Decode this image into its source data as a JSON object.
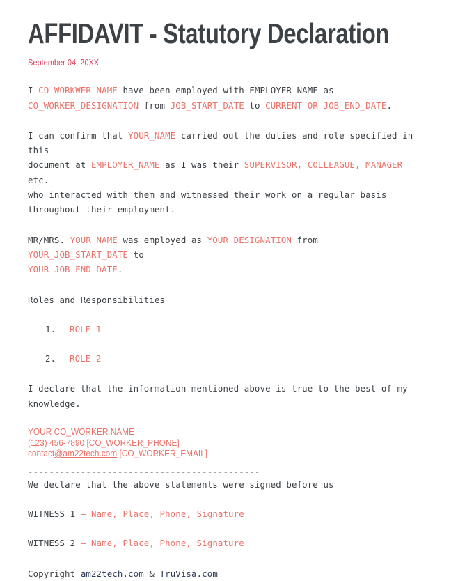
{
  "document": {
    "title": "AFFIDAVIT - Statutory Declaration",
    "date": "September 04, 20XX"
  },
  "paragraph1": {
    "t1": "I ",
    "co_worker_name": "CO_WORKWER_NAME",
    "t2": " have been employed with EMPLOYER_NAME as\n",
    "co_worker_designation": "CO_WORKER_DESIGNATION",
    "t3": " from ",
    "job_start_date": "JOB_START_DATE",
    "t4": " to ",
    "job_end_date": "CURRENT OR JOB_END_DATE",
    "t5": "."
  },
  "paragraph2": {
    "t1": "I can confirm that ",
    "your_name": "YOUR_NAME",
    "t2": " carried out the duties and role specified in this\ndocument at ",
    "employer_name": "EMPLOYER_NAME",
    "t3": " as I was their ",
    "relationship": "SUPERVISOR, COLLEAGUE, MANAGER",
    "t4": " etc.\nwho interacted with them and witnessed their work on a regular basis\nthroughout their employment."
  },
  "paragraph3": {
    "t1": "MR/MRS. ",
    "your_name": "YOUR_NAME",
    "t2": " was employed as ",
    "your_designation": "YOUR_DESIGNATION",
    "t3": " from ",
    "your_job_start_date": "YOUR_JOB_START_DATE",
    "t4": " to\n",
    "your_job_end_date": "YOUR_JOB_END_DATE",
    "t5": "."
  },
  "roles": {
    "heading": "Roles and Responsibilities",
    "items": [
      {
        "marker": "1.",
        "label": "ROLE 1"
      },
      {
        "marker": "2.",
        "label": "ROLE 2"
      }
    ]
  },
  "declaration": {
    "text": "I declare that the information mentioned above is true to the best of my\nknowledge."
  },
  "contact": {
    "name": "YOUR CO_WORKER NAME",
    "phone": "(123) 456-7890 [CO_WORKER_PHONE]",
    "email_prefix": "contact",
    "email_link": "@am22tech.com",
    "email_suffix": " [CO_WORKER_EMAIL]"
  },
  "witness_section": {
    "divider": "--------------------------------------------",
    "intro": "We declare that the above statements were signed before us",
    "witnesses": [
      {
        "label": "WITNESS 1 ",
        "dash": "– ",
        "fields": "Name, Place, Phone, Signature"
      },
      {
        "label": "WITNESS 2 ",
        "dash": "– ",
        "fields": "Name, Place, Phone, Signature"
      }
    ]
  },
  "footer": {
    "prefix": "Copyright ",
    "link1": "am22tech.com",
    "separator": " & ",
    "link2": "TruVisa.com"
  },
  "colors": {
    "placeholder_red": "#e8736a",
    "date_red": "#d9455f",
    "body_text": "#3a3f44",
    "title_text": "#3c4145",
    "link_navy": "#2f3a56",
    "divider_gray": "#9aa0a6",
    "background": "#ffffff"
  }
}
